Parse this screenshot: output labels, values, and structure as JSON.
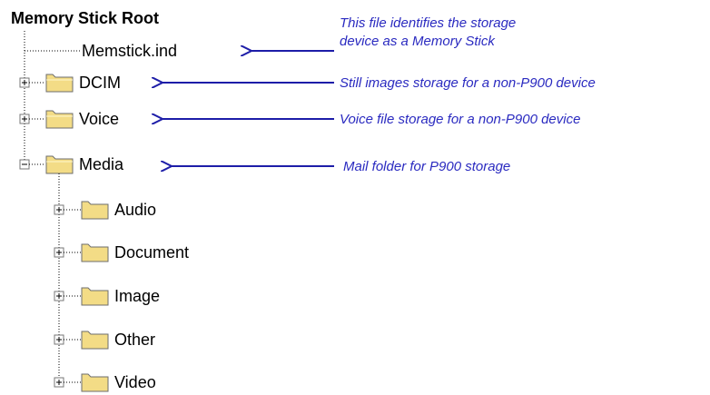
{
  "colors": {
    "tree_line": "#000000",
    "arrow": "#1d1da8",
    "note_text": "#2a2ac0",
    "folder_fill": "#f3dc86",
    "folder_stroke": "#6e6e6e"
  },
  "tree": {
    "root_label": "Memory Stick Root",
    "file_label": "Memstick.ind",
    "top_folders": [
      {
        "label": "DCIM",
        "expanded": false
      },
      {
        "label": "Voice",
        "expanded": false
      },
      {
        "label": "Media",
        "expanded": true
      }
    ],
    "media_children": [
      {
        "label": "Audio"
      },
      {
        "label": "Document"
      },
      {
        "label": "Image"
      },
      {
        "label": "Other"
      },
      {
        "label": "Video"
      }
    ]
  },
  "annotations": {
    "memstick_line1": "This file identifies the storage",
    "memstick_line2": "device as a Memory Stick",
    "dcim": "Still images storage for a non-P900 device",
    "voice": "Voice file storage for a non-P900 device",
    "media": "Mail folder for P900 storage"
  }
}
